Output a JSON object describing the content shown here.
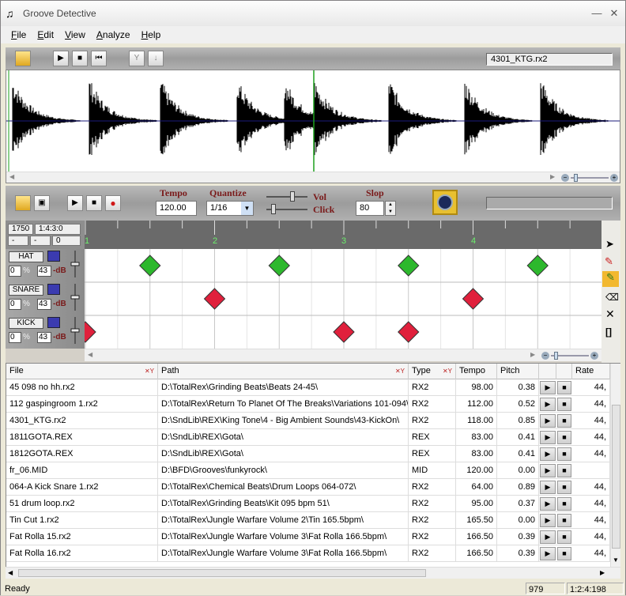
{
  "window": {
    "title": "Groove Detective",
    "minimize": "—",
    "close": "✕"
  },
  "menu": [
    "File",
    "Edit",
    "View",
    "Analyze",
    "Help"
  ],
  "top_toolbar": {
    "filename": "4301_KTG.rx2"
  },
  "groove_toolbar": {
    "tempo_label": "Tempo",
    "tempo_value": "120.00",
    "quantize_label": "Quantize",
    "quantize_value": "1/16",
    "vol_label": "Vol",
    "click_label": "Click",
    "slop_label": "Slop",
    "slop_value": "80"
  },
  "position": {
    "ticks": "1750",
    "bbt": "1:4:3:0",
    "a": "-",
    "b": "-",
    "c": "0"
  },
  "timeline": {
    "markers": [
      "1",
      "2",
      "3",
      "4"
    ]
  },
  "instruments": [
    {
      "name": "HAT",
      "vol": "0",
      "pct": "%",
      "db": "43",
      "db_label": "-dB",
      "hits": [
        1,
        3,
        5,
        7
      ],
      "color": "#2db82d"
    },
    {
      "name": "SNARE",
      "vol": "0",
      "pct": "%",
      "db": "43",
      "db_label": "-dB",
      "hits": [
        2,
        6
      ],
      "color": "#e0203c"
    },
    {
      "name": "KICK",
      "vol": "0",
      "pct": "%",
      "db": "43",
      "db_label": "-dB",
      "hits": [
        0,
        4,
        5
      ],
      "color": "#e0203c"
    }
  ],
  "table": {
    "headers": {
      "file": "File",
      "path": "Path",
      "type": "Type",
      "tempo": "Tempo",
      "pitch": "Pitch",
      "rate": "Rate"
    },
    "rows": [
      {
        "file": "45 098 no hh.rx2",
        "path": "D:\\TotalRex\\Grinding Beats\\Beats 24-45\\",
        "type": "RX2",
        "tempo": "98.00",
        "pitch": "0.38",
        "rate": "44,"
      },
      {
        "file": "112 gaspingroom 1.rx2",
        "path": "D:\\TotalRex\\Return To Planet Of The Breaks\\Variations 101-094\\",
        "type": "RX2",
        "tempo": "112.00",
        "pitch": "0.52",
        "rate": "44,"
      },
      {
        "file": "4301_KTG.rx2",
        "path": "D:\\SndLib\\REX\\King Tone\\4 - Big Ambient Sounds\\43-KickOn\\",
        "type": "RX2",
        "tempo": "118.00",
        "pitch": "0.85",
        "rate": "44,"
      },
      {
        "file": "1811GOTA.REX",
        "path": "D:\\SndLib\\REX\\Gota\\",
        "type": "REX",
        "tempo": "83.00",
        "pitch": "0.41",
        "rate": "44,"
      },
      {
        "file": "1812GOTA.REX",
        "path": "D:\\SndLib\\REX\\Gota\\",
        "type": "REX",
        "tempo": "83.00",
        "pitch": "0.41",
        "rate": "44,"
      },
      {
        "file": "fr_06.MID",
        "path": "D:\\BFD\\Grooves\\funkyrock\\",
        "type": "MID",
        "tempo": "120.00",
        "pitch": "0.00",
        "rate": ""
      },
      {
        "file": "064-A Kick Snare 1.rx2",
        "path": "D:\\TotalRex\\Chemical Beats\\Drum Loops 064-072\\",
        "type": "RX2",
        "tempo": "64.00",
        "pitch": "0.89",
        "rate": "44,"
      },
      {
        "file": "51 drum loop.rx2",
        "path": "D:\\TotalRex\\Grinding Beats\\Kit 095 bpm 51\\",
        "type": "RX2",
        "tempo": "95.00",
        "pitch": "0.37",
        "rate": "44,"
      },
      {
        "file": "Tin Cut 1.rx2",
        "path": "D:\\TotalRex\\Jungle Warfare Volume 2\\Tin 165.5bpm\\",
        "type": "RX2",
        "tempo": "165.50",
        "pitch": "0.00",
        "rate": "44,"
      },
      {
        "file": "Fat Rolla 15.rx2",
        "path": "D:\\TotalRex\\Jungle Warfare Volume 3\\Fat Rolla 166.5bpm\\",
        "type": "RX2",
        "tempo": "166.50",
        "pitch": "0.39",
        "rate": "44,"
      },
      {
        "file": "Fat Rolla 16.rx2",
        "path": "D:\\TotalRex\\Jungle Warfare Volume 3\\Fat Rolla 166.5bpm\\",
        "type": "RX2",
        "tempo": "166.50",
        "pitch": "0.39",
        "rate": "44,"
      }
    ]
  },
  "status": {
    "text": "Ready",
    "count": "979",
    "pos": "1:2:4:198"
  }
}
